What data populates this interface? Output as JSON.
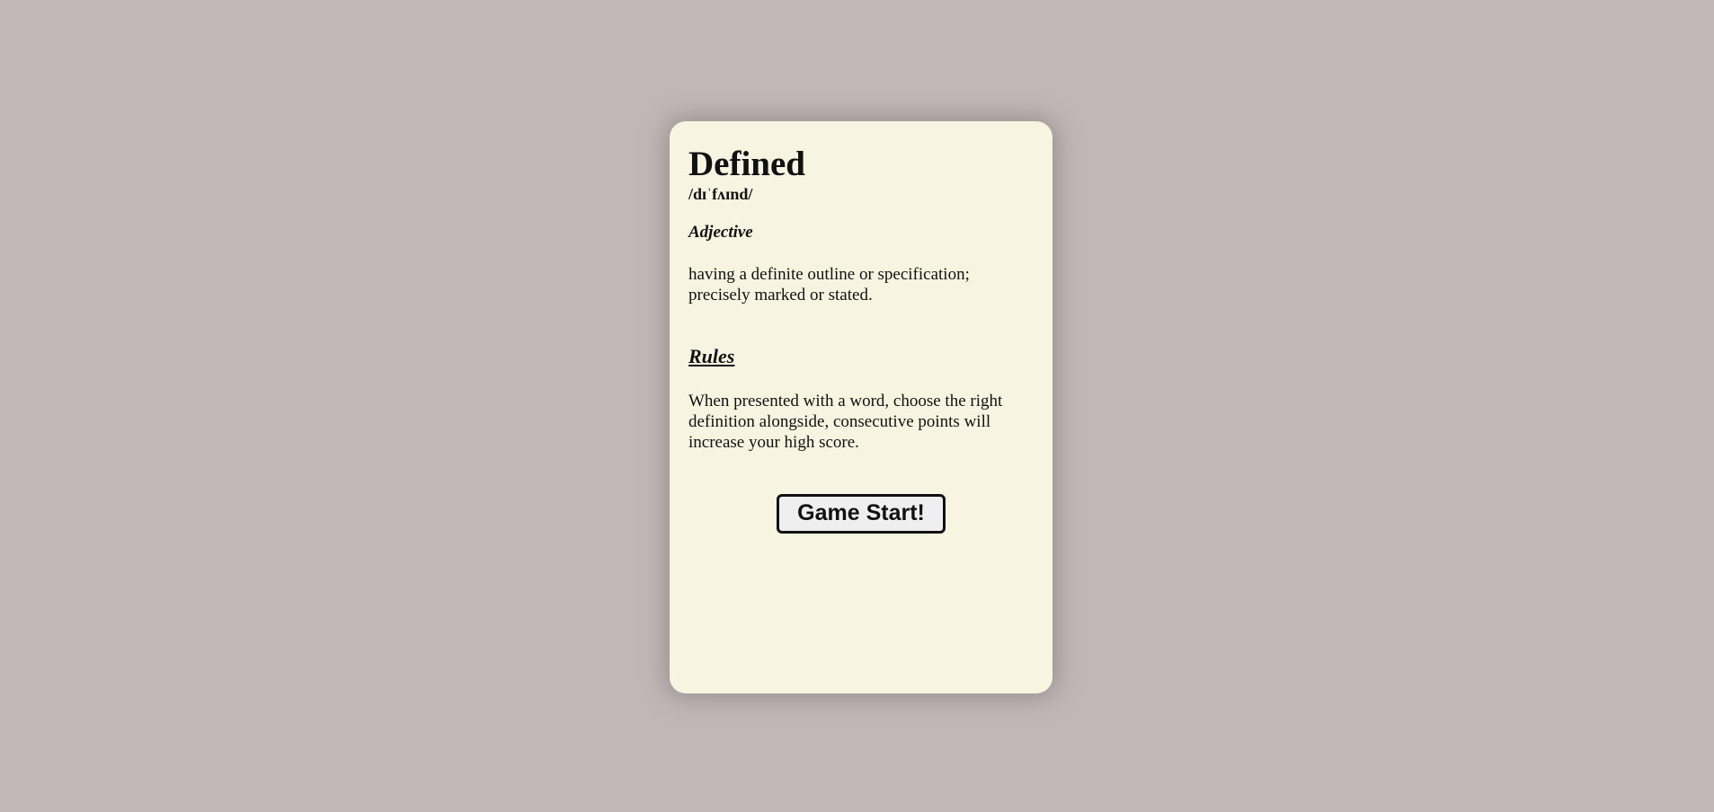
{
  "card": {
    "word": "Defined",
    "pronunciation": "/dɪˈfʌɪnd/",
    "part_of_speech": "Adjective",
    "definition": "having a definite outline or specification; precisely marked or stated.",
    "rules_heading": "Rules",
    "rules_text": "When presented with a word, choose the right definition alongside, consecutive points will increase your high score.",
    "start_button_label": "Game Start!"
  },
  "colors": {
    "page_background": "#c0b7b6",
    "card_background": "#f7f4e2",
    "button_background": "#efefef",
    "text": "#111111"
  }
}
